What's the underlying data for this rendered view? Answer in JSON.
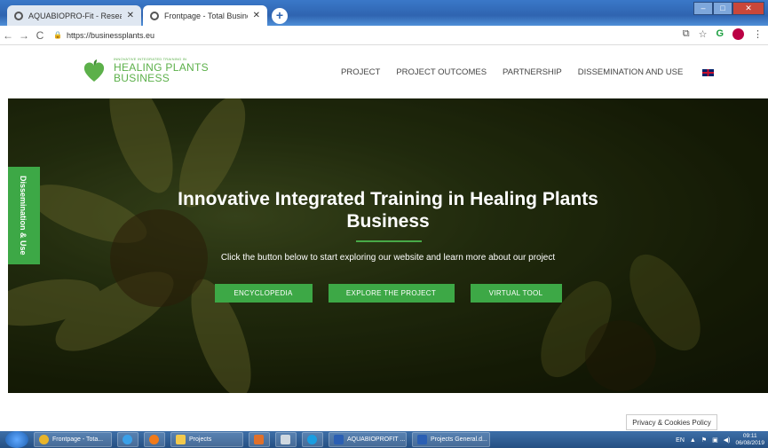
{
  "browser": {
    "tabs": [
      {
        "title": "AQUABIOPRO-Fit - Research and",
        "active": false
      },
      {
        "title": "Frontpage - Total Business Plan",
        "active": true
      }
    ],
    "url": "https://businessplants.eu"
  },
  "site": {
    "logo": {
      "small": "INNOVATIVE INTEGRATED TRAINING IN",
      "line1": "HEALING PLANTS",
      "line2": "BUSINESS"
    },
    "nav": [
      "PROJECT",
      "PROJECT OUTCOMES",
      "PARTNERSHIP",
      "DISSEMINATION AND USE"
    ],
    "side_tab": "Dissemination & Use",
    "hero": {
      "title_line1": "Innovative Integrated Training in Healing Plants",
      "title_line2": "Business",
      "subtitle": "Click the button below to start exploring our website and learn more about our project",
      "buttons": [
        "ENCYCLOPEDIA",
        "EXPLORE THE PROJECT",
        "VIRTUAL TOOL"
      ]
    },
    "privacy": "Privacy & Cookies Policy",
    "accent_color": "#3da846"
  },
  "taskbar": {
    "items": [
      "Frontpage - Tota...",
      "Projects",
      "AQUABIOPROFIT ...",
      "Projects General.d..."
    ],
    "lang": "EN",
    "time": "09:11",
    "date": "06/08/2019"
  }
}
